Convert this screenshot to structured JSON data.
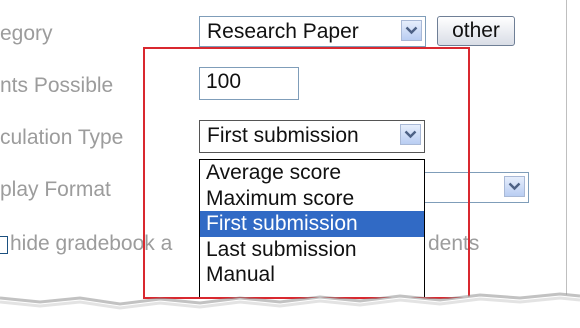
{
  "form": {
    "category": {
      "label": "egory",
      "value": "Research Paper",
      "other_button": "other"
    },
    "points_possible": {
      "label": "nts Possible",
      "value": "100"
    },
    "calculation_type": {
      "label": "culation Type",
      "value": "First submission",
      "options": [
        {
          "label": "Average score",
          "selected": false
        },
        {
          "label": "Maximum score",
          "selected": false
        },
        {
          "label": "First submission",
          "selected": true
        },
        {
          "label": "Last submission",
          "selected": false
        },
        {
          "label": "Manual",
          "selected": false
        }
      ]
    },
    "display_format": {
      "label": "play Format"
    },
    "hide_gradebook": {
      "label_left": "hide gradebook a",
      "label_right": "dents"
    }
  },
  "colors": {
    "highlight": "#d9282f",
    "selected_option": "#316ac5"
  },
  "icons": {
    "dropdown_arrow": "chevron-down-icon"
  }
}
